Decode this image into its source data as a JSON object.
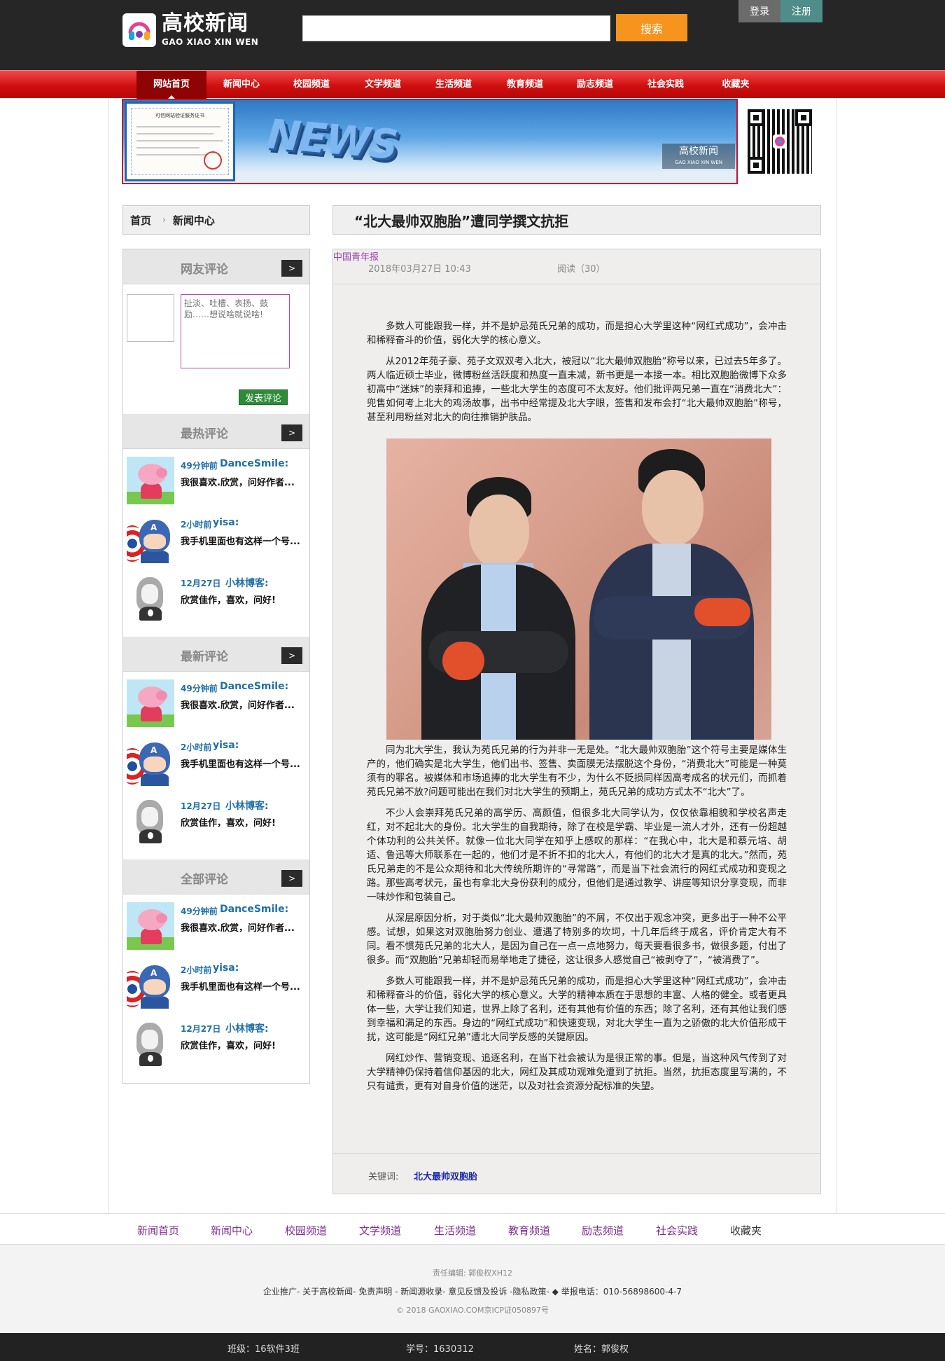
{
  "header": {
    "logo_title": "高校新闻",
    "logo_sub": "GAO XIAO XIN WEN",
    "search_placeholder": "",
    "search_button": "搜索",
    "login": "登录",
    "register": "注册"
  },
  "nav": {
    "items": [
      "网站首页",
      "新闻中心",
      "校园频道",
      "文学频道",
      "生活频道",
      "教育频道",
      "励志频道",
      "社会实践",
      "收藏夹"
    ],
    "active_index": 0
  },
  "banner": {
    "art_text": "NEWS",
    "brand_title": "高校新闻",
    "brand_sub": "GAO XIAO XIN WEN",
    "cert_title": "可信网站验证服务证书"
  },
  "breadcrumb": {
    "home": "首页",
    "current": "新闻中心"
  },
  "sidebar": {
    "comment_box": {
      "title": "网友评论",
      "more": ">",
      "placeholder": "扯淡、吐槽、表扬、鼓励……想说啥就说啥!",
      "submit": "发表评论"
    },
    "sections": [
      {
        "title": "最热评论",
        "more": ">",
        "entries": [
          {
            "avatar": "peppa-pig-avatar",
            "time": "49分钟前",
            "user": "DanceSmile:",
            "text": "我很喜欢.欣赏，问好作者..."
          },
          {
            "avatar": "captain-america-avatar",
            "time": "2小时前",
            "user": "yisa:",
            "text": "我手机里面也有这样一个号..."
          },
          {
            "avatar": "girl-avatar",
            "time": "12月27日",
            "user": "小林博客:",
            "text": "欣赏佳作，喜欢，问好!"
          }
        ]
      },
      {
        "title": "最新评论",
        "more": ">",
        "entries": [
          {
            "avatar": "peppa-pig-avatar",
            "time": "49分钟前",
            "user": "DanceSmile:",
            "text": "我很喜欢.欣赏，问好作者..."
          },
          {
            "avatar": "captain-america-avatar",
            "time": "2小时前",
            "user": "yisa:",
            "text": "我手机里面也有这样一个号..."
          },
          {
            "avatar": "girl-avatar",
            "time": "12月27日",
            "user": "小林博客:",
            "text": "欣赏佳作，喜欢，问好!"
          }
        ]
      },
      {
        "title": "全部评论",
        "more": ">",
        "entries": [
          {
            "avatar": "peppa-pig-avatar",
            "time": "49分钟前",
            "user": "DanceSmile:",
            "text": "我很喜欢.欣赏，问好作者..."
          },
          {
            "avatar": "captain-america-avatar",
            "time": "2小时前",
            "user": "yisa:",
            "text": "我手机里面也有这样一个号..."
          },
          {
            "avatar": "girl-avatar",
            "time": "12月27日",
            "user": "小林博客:",
            "text": "欣赏佳作，喜欢，问好!"
          }
        ]
      }
    ]
  },
  "article": {
    "title": "“北大最帅双胞胎”遭同学撰文抗拒",
    "date": "2018年03月27日 10:43",
    "source": "中国青年报",
    "reads": "阅读（30）",
    "paragraphs_before_image": [
      "多数人可能跟我一样，并不是妒忌苑氏兄弟的成功，而是担心大学里这种“网红式成功”，会冲击和稀释奋斗的价值，弱化大学的核心意义。",
      "从2012年苑子豪、苑子文双双考入北大，被冠以“北大最帅双胞胎”称号以来，已过去5年多了。两人临近硕士毕业，微博粉丝活跃度和热度一直未减，新书更是一本接一本。相比双胞胎微博下众多初高中“迷妹”的崇拜和追捧，一些北大学生的态度可不太友好。他们批评两兄弟一直在“消费北大”：兜售如何考上北大的鸡汤故事，出书中经常提及北大字眼，签售和发布会打“北大最帅双胞胎”称号，甚至利用粉丝对北大的向往推销护肤品。"
    ],
    "paragraphs_after_image": [
      "同为北大学生，我认为苑氏兄弟的行为并非一无是处。“北大最帅双胞胎”这个符号主要是媒体生产的，他们确实是北大学生，他们出书、签售、卖面膜无法摆脱这个身份，“消费北大”可能是一种莫须有的罪名。被媒体和市场追捧的北大学生有不少，为什么不贬损同样因高考成名的状元们，而抓着苑氏兄弟不放?问题可能出在我们对北大学生的预期上，苑氏兄弟的成功方式太不“北大”了。",
      "不少人会崇拜苑氏兄弟的高学历、高颜值，但很多北大同学认为，仅仅依靠相貌和学校名声走红，对不起北大的身份。北大学生的自我期待，除了在校是学霸、毕业是一流人才外，还有一份超越个体功利的公共关怀。就像一位北大同学在知乎上感叹的那样：“在我心中，北大是和蔡元培、胡适、鲁迅等大师联系在一起的，他们才是不折不扣的北大人，有他们的北大才是真的北大。”然而，苑氏兄弟走的不是公众期待和北大传统所期许的“寻常路”，而是当下社会流行的网红式成功和变现之路。那些高考状元，虽也有拿北大身份获利的成分，但他们是通过教学、讲座等知识分享变现，而非一味炒作和包装自己。",
      "从深层原因分析，对于类似“北大最帅双胞胎”的不屑，不仅出于观念冲突，更多出于一种不公平感。试想，如果这对双胞胎努力创业、遭遇了特别多的坎坷，十几年后终于成名，评价肯定大有不同。看不惯苑氏兄弟的北大人，是因为自己在一点一点地努力，每天要看很多书，做很多题，付出了很多。而“双胞胎”兄弟却轻而易举地走了捷径，这让很多人感觉自己“被剥夺了”，“被消费了”。",
      "多数人可能跟我一样，并不是妒忌苑氏兄弟的成功，而是担心大学里这种“网红式成功”，会冲击和稀释奋斗的价值，弱化大学的核心意义。大学的精神本质在于思想的丰富、人格的健全。或者更具体一些，大学让我们知道，世界上除了名利，还有其他有价值的东西；除了名利，还有其他让我们感到幸福和满足的东西。身边的“网红式成功”和快速变现，对北大学生一直为之骄傲的北大价值形成干扰，这可能是“网红兄弟”遭北大同学反感的关键原因。",
      "网红炒作、营销变现、追逐名利，在当下社会被认为是很正常的事。但是，当这种风气传到了对大学精神仍保持着信仰基因的北大，网红及其成功观难免遭到了抗拒。当然，抗拒态度里写满的，不只有谴责，更有对自身价值的迷茫，以及对社会资源分配标准的失望。"
    ],
    "keywords_label": "关键词:",
    "keywords_value": "北大最帅双胞胎"
  },
  "footer": {
    "nav": [
      "新闻首页",
      "新闻中心",
      "校园频道",
      "文学频道",
      "生活频道",
      "教育频道",
      "励志频道",
      "社会实践",
      "收藏夹"
    ],
    "editor": "责任编辑: 郭俊权XH12",
    "links": "企业推广- 关于高校新闻- 免责声明 - 新闻源收录- 意见反馈及投诉 -隐私政策-  ◆  举报电话：010-56898600-4-7",
    "copyright": "© 2018 GAOXIAO.COM京ICP证050897号",
    "class_info": "班级：16软件3班",
    "student_id": "学号：1630312",
    "name": "姓名：郭俊权"
  },
  "colors": {
    "header_bg": "#262626",
    "nav_red": "#d10f0f",
    "search_orange": "#f7941d",
    "link_blue": "#1f6fa8",
    "source_purple": "#9b3bb5"
  }
}
